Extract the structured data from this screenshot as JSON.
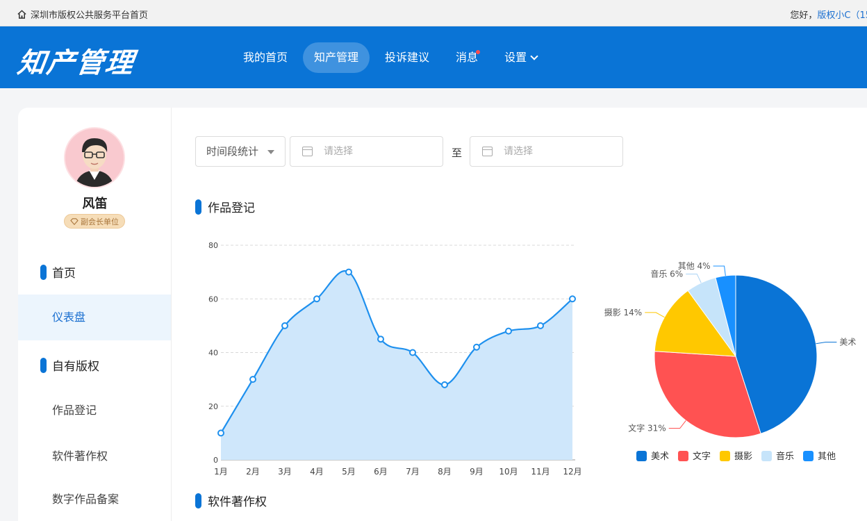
{
  "topbar": {
    "home_label": "深圳市版权公共服务平台首页",
    "greeting": "您好，",
    "username": "版权小C（15"
  },
  "header": {
    "logo": "知产管理",
    "nav": [
      {
        "label": "我的首页",
        "active": false
      },
      {
        "label": "知产管理",
        "active": true
      },
      {
        "label": "投诉建议",
        "active": false
      },
      {
        "label": "消息",
        "active": false,
        "dot": true
      },
      {
        "label": "设置",
        "active": false,
        "dropdown": true
      }
    ]
  },
  "sidebar": {
    "user_name": "风笛",
    "badge": "副会长单位",
    "sections": [
      {
        "label": "首页",
        "items": [
          "仪表盘"
        ]
      },
      {
        "label": "自有版权",
        "items": [
          "作品登记",
          "软件著作权",
          "数字作品备案"
        ]
      }
    ],
    "active_item": "仪表盘"
  },
  "filters": {
    "period_select": "时间段统计",
    "start_placeholder": "请选择",
    "to_label": "至",
    "end_placeholder": "请选择"
  },
  "sections": {
    "works_title": "作品登记",
    "software_title": "软件著作权"
  },
  "chart_data": [
    {
      "type": "area",
      "x": [
        "1月",
        "2月",
        "3月",
        "4月",
        "5月",
        "6月",
        "7月",
        "8月",
        "9月",
        "10月",
        "11月",
        "12月"
      ],
      "values": [
        10,
        30,
        50,
        60,
        70,
        45,
        40,
        28,
        42,
        48,
        50,
        60
      ],
      "ylim": [
        0,
        80
      ],
      "yticks": [
        0,
        20,
        40,
        60,
        80
      ],
      "grid": true,
      "colors": {
        "line": "#1e90ee",
        "fill": "#cfe7fb"
      }
    },
    {
      "type": "pie",
      "slices": [
        {
          "label": "美术",
          "value": 45,
          "display": "美术",
          "color": "#0a74d6"
        },
        {
          "label": "文字",
          "value": 31,
          "display": "文字 31%",
          "color": "#ff5252"
        },
        {
          "label": "摄影",
          "value": 14,
          "display": "摄影 14%",
          "color": "#ffc800"
        },
        {
          "label": "音乐",
          "value": 6,
          "display": "音乐 6%",
          "color": "#c6e4fa"
        },
        {
          "label": "其他",
          "value": 4,
          "display": "其他 4%",
          "color": "#1890ff"
        }
      ],
      "legend_placement": "bottom"
    }
  ]
}
